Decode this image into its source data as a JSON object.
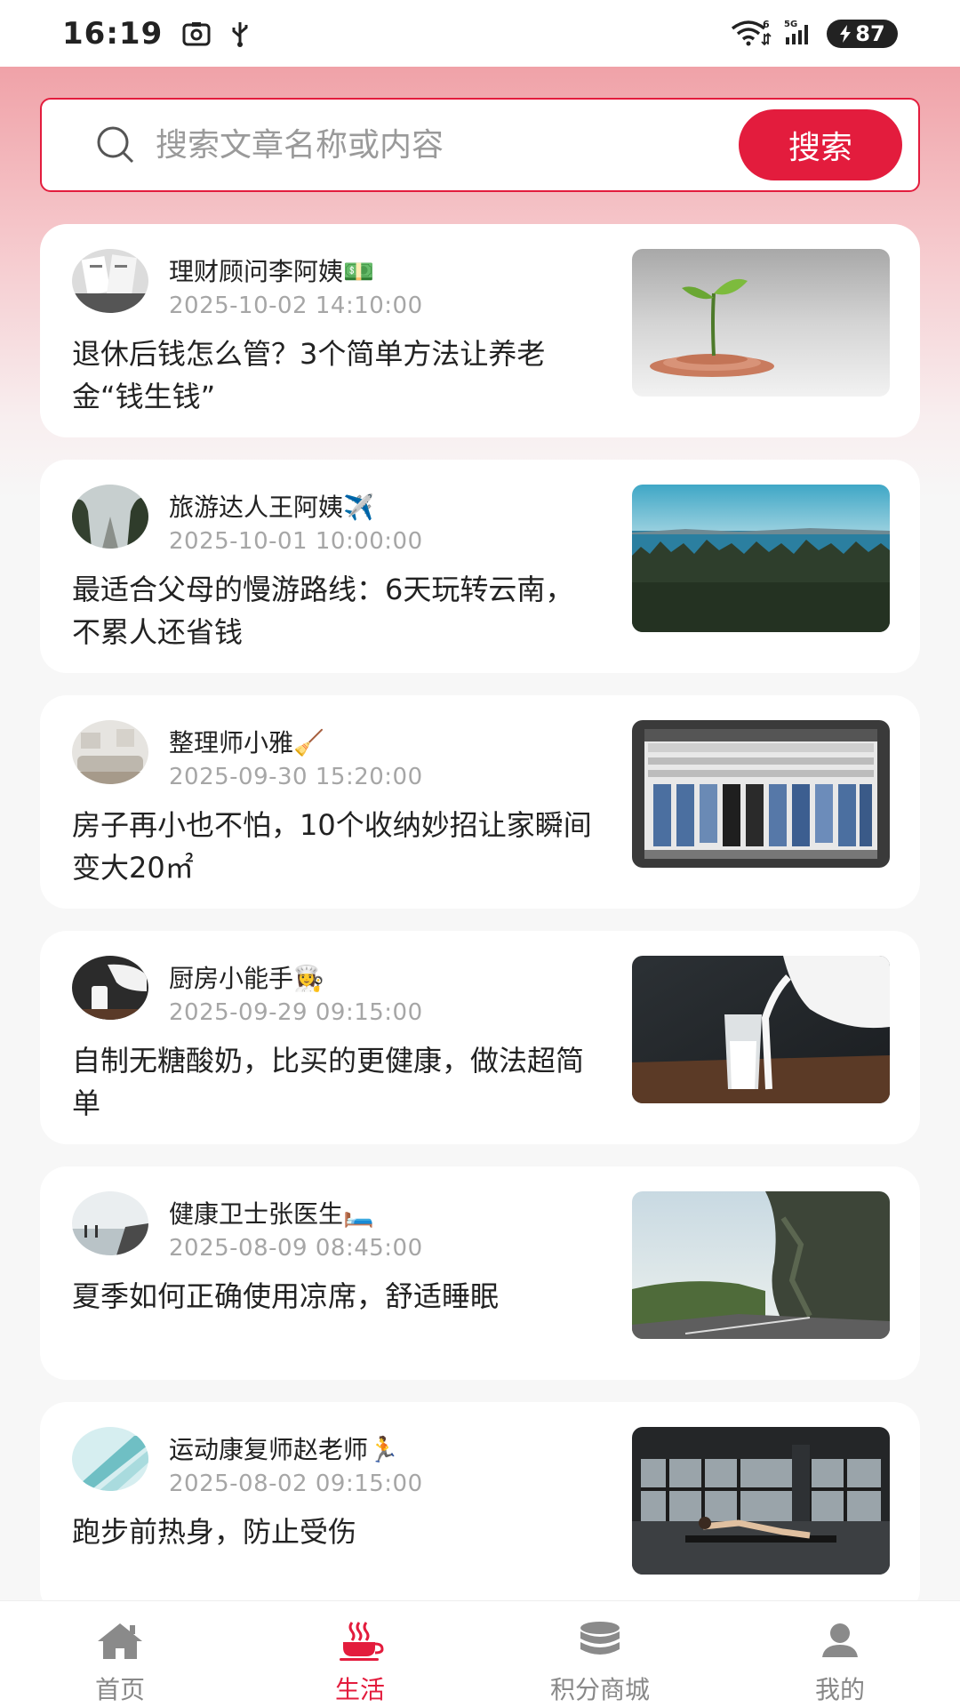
{
  "status_bar": {
    "time": "16:19",
    "battery": "87",
    "wifi_label": "6",
    "signal_label": "5G"
  },
  "search": {
    "placeholder": "搜索文章名称或内容",
    "button_label": "搜索"
  },
  "articles": [
    {
      "author": "理财顾问李阿姨💵",
      "date": "2025-10-02 14:10:00",
      "title": "退休后钱怎么管？3个简单方法让养老金“钱生钱”"
    },
    {
      "author": "旅游达人王阿姨✈️",
      "date": "2025-10-01 10:00:00",
      "title": "最适合父母的慢游路线：6天玩转云南，不累人还省钱"
    },
    {
      "author": "整理师小雅🧹",
      "date": "2025-09-30 15:20:00",
      "title": "房子再小也不怕，10个收纳妙招让家瞬间变大20㎡"
    },
    {
      "author": "厨房小能手👩‍🍳",
      "date": "2025-09-29 09:15:00",
      "title": "自制无糖酸奶，比买的更健康，做法超简单"
    },
    {
      "author": "健康卫士张医生🛏️",
      "date": "2025-08-09 08:45:00",
      "title": "夏季如何正确使用凉席，舒适睡眠"
    },
    {
      "author": "运动康复师赵老师🏃",
      "date": "2025-08-02 09:15:00",
      "title": "跑步前热身，防止受伤"
    }
  ],
  "tabs": [
    {
      "label": "首页",
      "icon": "home-icon"
    },
    {
      "label": "生活",
      "icon": "coffee-cup-icon",
      "active": true
    },
    {
      "label": "积分商城",
      "icon": "coin-stack-icon"
    },
    {
      "label": "我的",
      "icon": "user-icon"
    }
  ],
  "colors": {
    "accent": "#e31c3d",
    "header_pink": "#f0a2a8",
    "inactive": "#888888"
  }
}
